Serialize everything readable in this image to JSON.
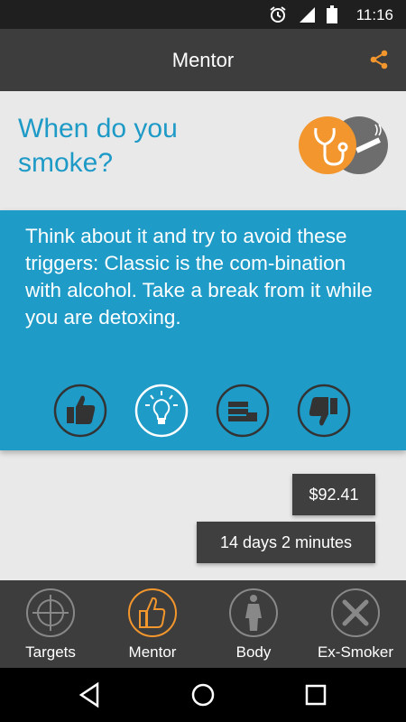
{
  "status_bar": {
    "time": "11:16",
    "icons": [
      "alarm-icon",
      "signal-icon",
      "battery-icon"
    ]
  },
  "app_bar": {
    "title": "Mentor",
    "share_icon": "share-icon"
  },
  "topic": {
    "heading": "When do you smoke?",
    "icon": "doctor-no-smoking-icon"
  },
  "tip": {
    "text": "Think about it and try to avoid these triggers: Classic is the com-bination with alcohol. Take a break from it while you are detoxing.",
    "actions": [
      {
        "name": "thumbs-up",
        "icon": "thumbs-up-icon"
      },
      {
        "name": "idea",
        "icon": "lightbulb-icon"
      },
      {
        "name": "money",
        "icon": "money-stack-icon"
      },
      {
        "name": "thumbs-down",
        "icon": "thumbs-down-icon"
      }
    ]
  },
  "stats": {
    "money_saved": "$92.41",
    "time_smoke_free": "14 days 2 minutes"
  },
  "tabs": [
    {
      "label": "Targets",
      "icon": "crosshair-icon",
      "active": false
    },
    {
      "label": "Mentor",
      "icon": "thumbs-up-icon",
      "active": true
    },
    {
      "label": "Body",
      "icon": "body-icon",
      "active": false
    },
    {
      "label": "Ex-Smoker",
      "icon": "tools-icon",
      "active": false
    }
  ],
  "colors": {
    "accent_blue": "#1f9bc8",
    "accent_orange": "#f2962d",
    "dark_bar": "#3d3d3d",
    "background": "#e9e9e9"
  }
}
